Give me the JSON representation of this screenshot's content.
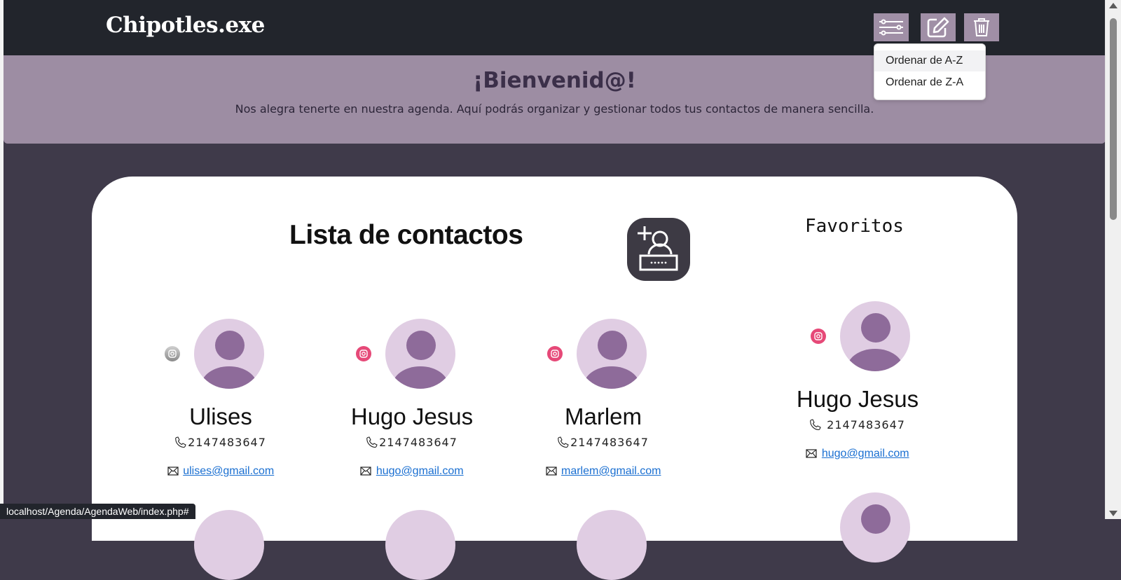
{
  "navbar": {
    "brand": "Chipotles.exe",
    "buttons": [
      {
        "name": "sort",
        "icon": "sliders-icon"
      },
      {
        "name": "edit",
        "icon": "edit-icon"
      },
      {
        "name": "delete",
        "icon": "trash-icon"
      }
    ]
  },
  "sort_menu": {
    "items": [
      "Ordenar de A-Z",
      "Ordenar de Z-A"
    ]
  },
  "banner": {
    "title": "¡Bienvenid@!",
    "text": "Nos alegra tenerte en nuestra agenda. Aquí podrás organizar y gestionar todos tus contactos de manera sencilla."
  },
  "contacts_section": {
    "title": "Lista de contactos",
    "add_button_icon": "add-user-icon",
    "contacts": [
      {
        "name": "Ulises",
        "phone": "2147483647",
        "email": "ulises@gmail.com",
        "favorite": false
      },
      {
        "name": "Hugo Jesus",
        "phone": "2147483647",
        "email": "hugo@gmail.com",
        "favorite": true
      },
      {
        "name": "Marlem",
        "phone": "2147483647",
        "email": "marlem@gmail.com",
        "favorite": true
      }
    ]
  },
  "favorites_section": {
    "title": "Favoritos",
    "contacts": [
      {
        "name": "Hugo Jesus",
        "phone": "2147483647",
        "email": "hugo@gmail.com"
      }
    ]
  },
  "status_bar": {
    "url": "localhost/Agenda/AgendaWeb/index.php#"
  },
  "colors": {
    "navbar_bg": "#22252c",
    "banner_bg": "#9d8da3",
    "page_bg": "#3f3a4a",
    "accent_button": "#a08fa6",
    "avatar_bg": "#e0cde3",
    "avatar_fg": "#8e6b9a",
    "favorite_pink": "#e64978",
    "link_blue": "#1a6fd1"
  }
}
